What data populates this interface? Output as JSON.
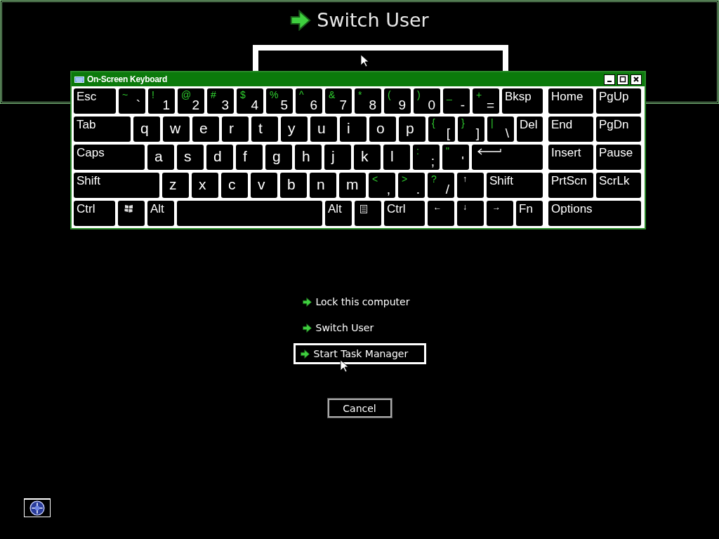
{
  "magnifier": {
    "label": "Switch User"
  },
  "keyboard": {
    "title": "On-Screen Keyboard",
    "rows": [
      {
        "keys": [
          {
            "kind": "label",
            "label": "Esc"
          },
          {
            "kind": "dual",
            "shift": "~",
            "label": "`"
          },
          {
            "kind": "dual",
            "shift": "!",
            "label": "1"
          },
          {
            "kind": "dual",
            "shift": "@",
            "label": "2"
          },
          {
            "kind": "dual",
            "shift": "#",
            "label": "3"
          },
          {
            "kind": "dual",
            "shift": "$",
            "label": "4"
          },
          {
            "kind": "dual",
            "shift": "%",
            "label": "5"
          },
          {
            "kind": "dual",
            "shift": "^",
            "label": "6"
          },
          {
            "kind": "dual",
            "shift": "&",
            "label": "7"
          },
          {
            "kind": "dual",
            "shift": "*",
            "label": "8"
          },
          {
            "kind": "dual",
            "shift": "(",
            "label": "9"
          },
          {
            "kind": "dual",
            "shift": ")",
            "label": "0"
          },
          {
            "kind": "dual",
            "shift": "_",
            "label": "-"
          },
          {
            "kind": "dual",
            "shift": "+",
            "label": "="
          },
          {
            "kind": "label",
            "label": "Bksp"
          }
        ]
      },
      {
        "keys": [
          {
            "kind": "label",
            "label": "Tab"
          },
          {
            "kind": "char",
            "label": "q"
          },
          {
            "kind": "char",
            "label": "w"
          },
          {
            "kind": "char",
            "label": "e"
          },
          {
            "kind": "char",
            "label": "r"
          },
          {
            "kind": "char",
            "label": "t"
          },
          {
            "kind": "char",
            "label": "y"
          },
          {
            "kind": "char",
            "label": "u"
          },
          {
            "kind": "char",
            "label": "i"
          },
          {
            "kind": "char",
            "label": "o"
          },
          {
            "kind": "char",
            "label": "p"
          },
          {
            "kind": "dual",
            "shift": "{",
            "label": "["
          },
          {
            "kind": "dual",
            "shift": "}",
            "label": "]"
          },
          {
            "kind": "dual",
            "shift": "|",
            "label": "\\"
          },
          {
            "kind": "label",
            "label": "Del"
          }
        ]
      },
      {
        "keys": [
          {
            "kind": "label",
            "label": "Caps"
          },
          {
            "kind": "char",
            "label": "a"
          },
          {
            "kind": "char",
            "label": "s"
          },
          {
            "kind": "char",
            "label": "d"
          },
          {
            "kind": "char",
            "label": "f"
          },
          {
            "kind": "char",
            "label": "g"
          },
          {
            "kind": "char",
            "label": "h"
          },
          {
            "kind": "char",
            "label": "j"
          },
          {
            "kind": "char",
            "label": "k"
          },
          {
            "kind": "char",
            "label": "l"
          },
          {
            "kind": "dual",
            "shift": ":",
            "label": ";"
          },
          {
            "kind": "dual",
            "shift": "\"",
            "label": "'"
          },
          {
            "kind": "enter"
          }
        ]
      },
      {
        "keys": [
          {
            "kind": "label",
            "label": "Shift"
          },
          {
            "kind": "char",
            "label": "z"
          },
          {
            "kind": "char",
            "label": "x"
          },
          {
            "kind": "char",
            "label": "c"
          },
          {
            "kind": "char",
            "label": "v"
          },
          {
            "kind": "char",
            "label": "b"
          },
          {
            "kind": "char",
            "label": "n"
          },
          {
            "kind": "char",
            "label": "m"
          },
          {
            "kind": "dual",
            "shift": "<",
            "label": ","
          },
          {
            "kind": "dual",
            "shift": ">",
            "label": "."
          },
          {
            "kind": "dual",
            "shift": "?",
            "label": "/"
          },
          {
            "kind": "arrow",
            "label": "↑"
          },
          {
            "kind": "label",
            "label": "Shift"
          }
        ]
      },
      {
        "keys": [
          {
            "kind": "label",
            "label": "Ctrl"
          },
          {
            "kind": "windows"
          },
          {
            "kind": "label",
            "label": "Alt"
          },
          {
            "kind": "space"
          },
          {
            "kind": "label",
            "label": "Alt"
          },
          {
            "kind": "menu"
          },
          {
            "kind": "label",
            "label": "Ctrl"
          },
          {
            "kind": "arrow",
            "label": "←"
          },
          {
            "kind": "arrow",
            "label": "↓"
          },
          {
            "kind": "arrow",
            "label": "→"
          },
          {
            "kind": "label",
            "label": "Fn"
          }
        ]
      }
    ],
    "nav": [
      {
        "keys": [
          {
            "label": "Home"
          },
          {
            "label": "PgUp"
          }
        ]
      },
      {
        "keys": [
          {
            "label": "End"
          },
          {
            "label": "PgDn"
          }
        ]
      },
      {
        "keys": [
          {
            "label": "Insert"
          },
          {
            "label": "Pause"
          }
        ]
      },
      {
        "keys": [
          {
            "label": "PrtScn"
          },
          {
            "label": "ScrLk"
          }
        ]
      },
      {
        "keys": [
          {
            "label": "Options"
          }
        ]
      }
    ]
  },
  "menu": {
    "items": [
      {
        "label": "Lock this computer",
        "selected": false
      },
      {
        "label": "Switch User",
        "selected": false
      },
      {
        "label": "Start Task Manager",
        "selected": true
      }
    ]
  },
  "cancel_button": {
    "label": "Cancel"
  }
}
